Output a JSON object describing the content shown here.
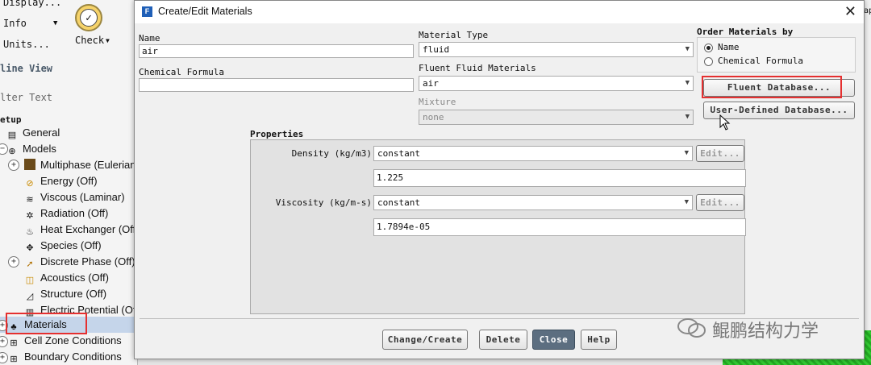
{
  "background": {
    "toolbar": {
      "display_label": "Display...",
      "info_label": "Info",
      "units_label": "Units...",
      "check_label": "Check"
    },
    "outline_view_title": "line View",
    "filter_placeholder": "lter Text",
    "tree": {
      "setup": "etup",
      "items": [
        {
          "label": "General"
        },
        {
          "label": "Models"
        },
        {
          "label": "Multiphase (Eulerian"
        },
        {
          "label": "Energy (Off)"
        },
        {
          "label": "Viscous (Laminar)"
        },
        {
          "label": "Radiation (Off)"
        },
        {
          "label": "Heat Exchanger (Off"
        },
        {
          "label": "Species (Off)"
        },
        {
          "label": "Discrete Phase (Off)"
        },
        {
          "label": "Acoustics (Off)"
        },
        {
          "label": "Structure (Off)"
        },
        {
          "label": "Electric Potential (Of"
        },
        {
          "label": "Materials"
        },
        {
          "label": "Cell Zone Conditions"
        },
        {
          "label": "Boundary Conditions"
        }
      ]
    },
    "right_edge_text": "ap",
    "highlight_color": "#e53030"
  },
  "dialog": {
    "title": "Create/Edit Materials",
    "name_label": "Name",
    "name_value": "air",
    "formula_label": "Chemical Formula",
    "formula_value": "",
    "material_type_label": "Material Type",
    "material_type_value": "fluid",
    "fluent_materials_label": "Fluent Fluid Materials",
    "fluent_materials_value": "air",
    "mixture_label": "Mixture",
    "mixture_value": "none",
    "order_by_title": "Order Materials by",
    "order_options": [
      "Name",
      "Chemical Formula"
    ],
    "order_selected": "Name",
    "fluent_db_button": "Fluent Database...",
    "user_db_button": "User-Defined Database...",
    "properties_title": "Properties",
    "density": {
      "label": "Density (kg/m3)",
      "method": "constant",
      "edit_button": "Edit...",
      "value": "1.225"
    },
    "viscosity": {
      "label": "Viscosity (kg/m-s)",
      "method": "constant",
      "edit_button": "Edit...",
      "value": "1.7894e-05"
    },
    "buttons": {
      "change_create": "Change/Create",
      "delete": "Delete",
      "close": "Close",
      "help": "Help"
    }
  },
  "watermark": "鲲鹏结构力学"
}
